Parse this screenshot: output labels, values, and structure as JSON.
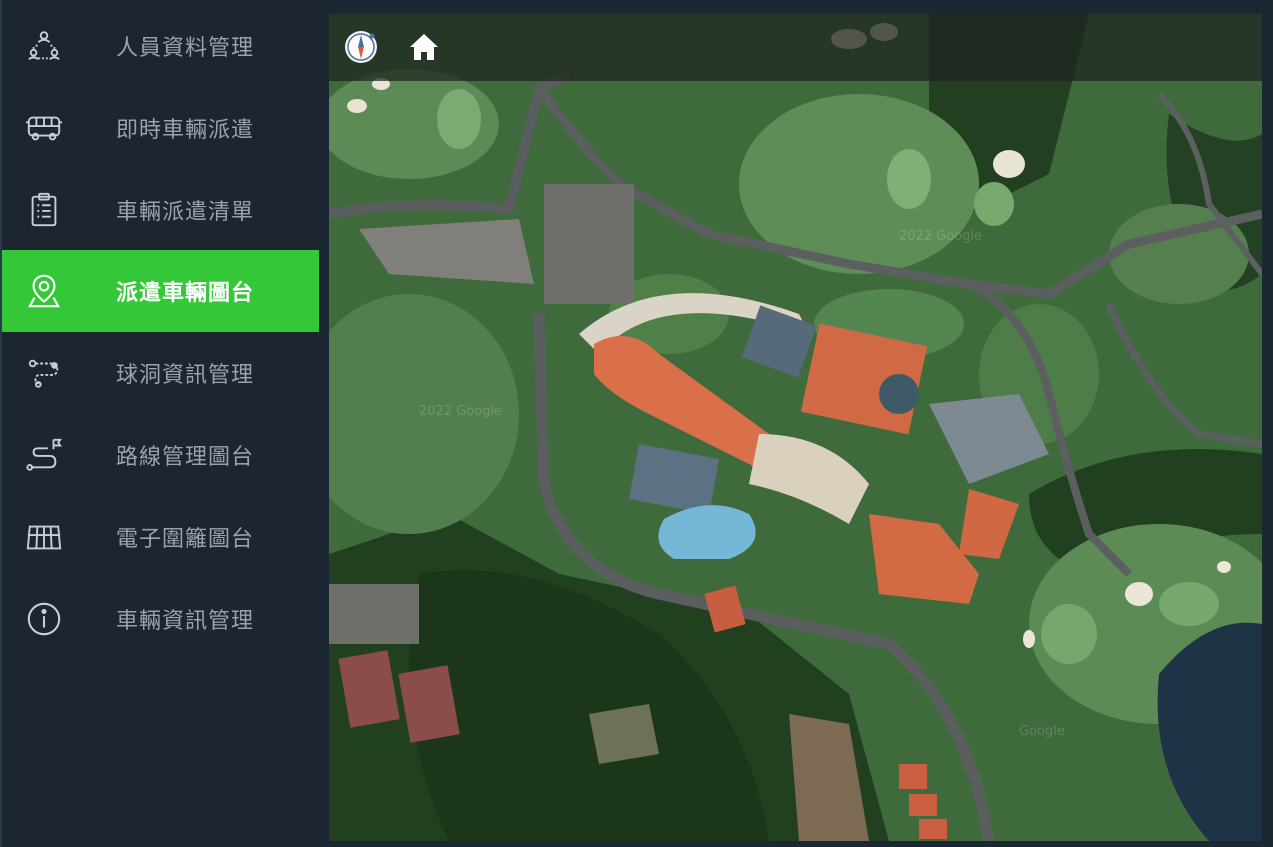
{
  "sidebar": {
    "items": [
      {
        "label": "人員資料管理",
        "icon": "people-network-icon",
        "active": false
      },
      {
        "label": "即時車輛派遣",
        "icon": "bus-icon",
        "active": false
      },
      {
        "label": "車輛派遣清單",
        "icon": "clipboard-list-icon",
        "active": false
      },
      {
        "label": "派遣車輛圖台",
        "icon": "map-pin-icon",
        "active": true
      },
      {
        "label": "球洞資訊管理",
        "icon": "route-path-icon",
        "active": false
      },
      {
        "label": "路線管理圖台",
        "icon": "route-flag-icon",
        "active": false
      },
      {
        "label": "電子圍籬圖台",
        "icon": "fence-icon",
        "active": false
      },
      {
        "label": "車輛資訊管理",
        "icon": "info-icon",
        "active": false
      }
    ]
  },
  "map": {
    "toolbar": {
      "compass": "compass-icon",
      "home": "home-icon"
    },
    "watermarks": [
      "2022 Google",
      "2022 Google",
      "Google"
    ]
  },
  "colors": {
    "sidebar_bg": "#1c2530",
    "active_bg": "#34c839",
    "label_inactive": "#9aa3ab",
    "label_active": "#ffffff"
  }
}
